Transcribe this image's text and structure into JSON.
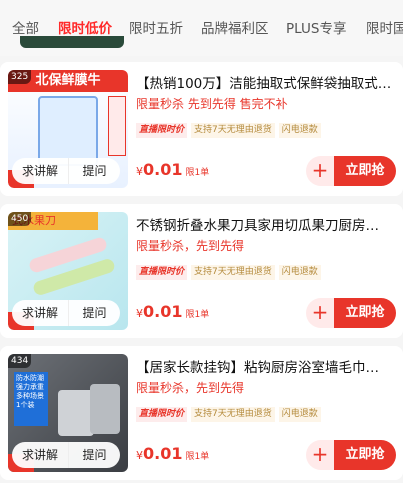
{
  "tabs": [
    "全部",
    "限时低价",
    "限时五折",
    "品牌福利区",
    "PLUS专享",
    "限时国"
  ],
  "active_tab_index": 1,
  "colors": {
    "accent": "#e8352a",
    "tag_text": "#b48a3b"
  },
  "products": [
    {
      "rank": "325",
      "thumb_text": "北保鲜膜牛",
      "title": "【热销100万】洁能抽取式保鲜袋抽取式…",
      "subtitle": "限量秒杀  先到先得  售完不补",
      "tags": [
        "直播限时价",
        "支持7天无理由退货",
        "闪电退款"
      ],
      "price_symbol": "¥",
      "price": "0.01",
      "limit": "限1单",
      "ask_label": "求讲解",
      "ask2_label": "提问",
      "buy_label": "立即抢",
      "plus_label": "+"
    },
    {
      "rank": "450",
      "thumb_text": "式水果刀",
      "title": "不锈钢折叠水果刀具家用切瓜果刀厨房…",
      "subtitle": "限量秒杀，先到先得",
      "tags": [
        "直播限时价",
        "支持7天无理由退货",
        "闪电退款"
      ],
      "price_symbol": "¥",
      "price": "0.01",
      "limit": "限1单",
      "ask_label": "求讲解",
      "ask2_label": "提问",
      "buy_label": "立即抢",
      "plus_label": "+"
    },
    {
      "rank": "434",
      "thumb_text": "防水防潮 强力承重 多种场景 1个装",
      "title": "【居家长款挂钩】粘钩厨房浴室墙毛巾…",
      "subtitle": "限量秒杀，先到先得",
      "tags": [
        "直播限时价",
        "支持7天无理由退货",
        "闪电退款"
      ],
      "price_symbol": "¥",
      "price": "0.01",
      "limit": "限1单",
      "ask_label": "求讲解",
      "ask2_label": "提问",
      "buy_label": "立即抢",
      "plus_label": "+"
    }
  ]
}
